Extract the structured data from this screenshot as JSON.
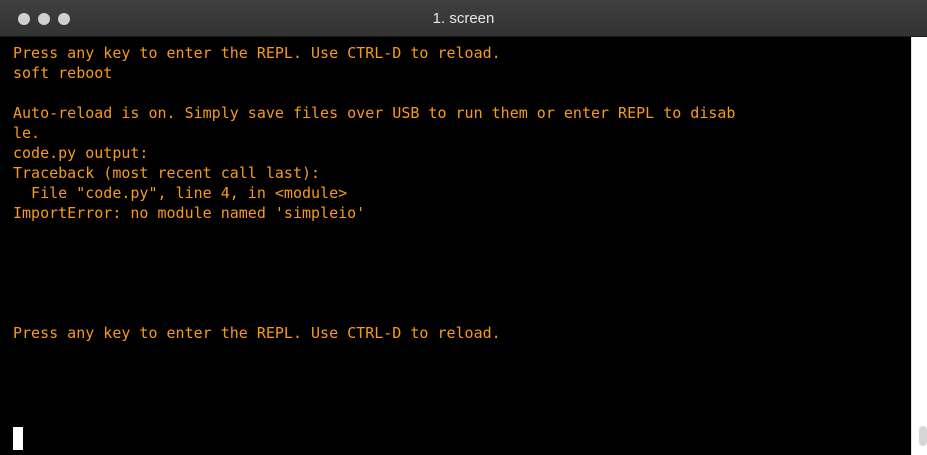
{
  "window": {
    "title": "1. screen"
  },
  "terminal": {
    "lines": [
      "Press any key to enter the REPL. Use CTRL-D to reload.",
      "soft reboot",
      "",
      "Auto-reload is on. Simply save files over USB to run them or enter REPL to disab",
      "le.",
      "code.py output:",
      "Traceback (most recent call last):",
      "  File \"code.py\", line 4, in <module>",
      "ImportError: no module named 'simpleio'",
      "",
      "",
      "",
      "",
      "",
      "Press any key to enter the REPL. Use CTRL-D to reload."
    ],
    "text_color": "#f79a1c",
    "background": "#000000"
  }
}
